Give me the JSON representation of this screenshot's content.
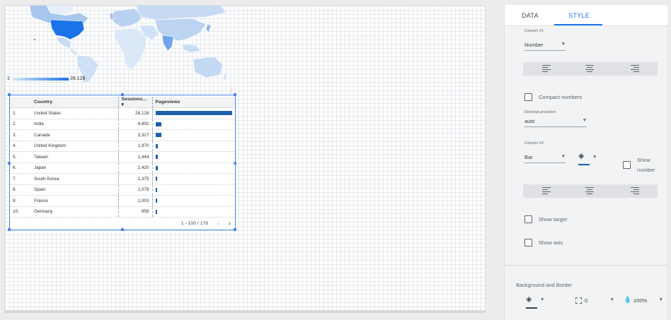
{
  "map": {
    "legend_min": "1",
    "legend_max": "28,128",
    "colors": {
      "high": "#1a73e8",
      "low": "#cfe0f5"
    }
  },
  "table": {
    "headers": {
      "country": "Country",
      "sessions": "Sessions",
      "pageviews": "Pageviews"
    },
    "sort_icon": "sort-descending-icon",
    "rows": [
      {
        "idx": "1.",
        "country": "United States",
        "sessions": "28,128",
        "pageviews_share": 1.0
      },
      {
        "idx": "2.",
        "country": "India",
        "sessions": "4,892",
        "pageviews_share": 0.075
      },
      {
        "idx": "3.",
        "country": "Canada",
        "sessions": "3,327",
        "pageviews_share": 0.075
      },
      {
        "idx": "4.",
        "country": "United Kingdom",
        "sessions": "1,970",
        "pageviews_share": 0.035
      },
      {
        "idx": "5.",
        "country": "Taiwan",
        "sessions": "1,444",
        "pageviews_share": 0.03
      },
      {
        "idx": "6.",
        "country": "Japan",
        "sessions": "1,420",
        "pageviews_share": 0.028
      },
      {
        "idx": "7.",
        "country": "South Korea",
        "sessions": "1,375",
        "pageviews_share": 0.025
      },
      {
        "idx": "8.",
        "country": "Spain",
        "sessions": "1,078",
        "pageviews_share": 0.018
      },
      {
        "idx": "9.",
        "country": "France",
        "sessions": "1,003",
        "pageviews_share": 0.018
      },
      {
        "idx": "10.",
        "country": "Germany",
        "sessions": "958",
        "pageviews_share": 0.018
      }
    ],
    "pagination": "1 - 100 / 178",
    "bar_color": "#1f5fae"
  },
  "panel": {
    "tabs": {
      "data": "DATA",
      "style": "STYLE"
    },
    "accent": "#1a73e8",
    "column1": {
      "label": "Column #1",
      "type": "Number"
    },
    "compact_numbers": "Compact numbers",
    "decimal_precision": {
      "label": "Decimal precision",
      "value": "auto"
    },
    "column2": {
      "label": "Column #2",
      "type": "Bar",
      "show_number_line1": "Show",
      "show_number_line2": "number"
    },
    "show_target": "Show target",
    "show_axis": "Show axis",
    "background_border": {
      "title": "Background and Border",
      "border_weight": "0",
      "opacity": "100%"
    }
  }
}
